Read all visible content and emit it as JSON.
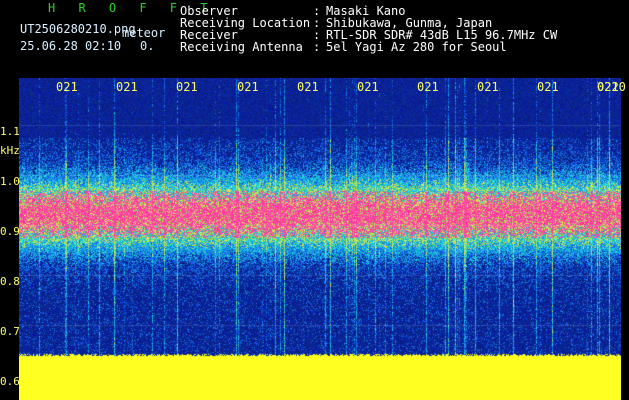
{
  "app": {
    "title": "H R O F F T"
  },
  "header": {
    "filename": "UT2506280210.png",
    "mode": "meteor",
    "date_time": "25.06.28 02:10",
    "count": "0.",
    "rows": [
      {
        "label": "Observer",
        "value": "Masaki Kano"
      },
      {
        "label": "Receiving Location",
        "value": "Shibukawa, Gunma, Japan"
      },
      {
        "label": "Receiver",
        "value": "RTL-SDR SDR# 43dB L15 96.7MHz CW"
      },
      {
        "label": "Receiving Antenna",
        "value": "5el Yagi Az 280 for Seoul"
      }
    ]
  },
  "axis": {
    "unit": "kHz",
    "y_ticks": [
      "1.1",
      "1.0",
      "0.9",
      "0.8",
      "0.7",
      "0.6"
    ],
    "time_ticks": [
      "021",
      "021",
      "021",
      "021",
      "021",
      "021",
      "021",
      "021",
      "021",
      "021",
      "0220"
    ]
  },
  "colors": {
    "background": "#000000",
    "spectrum_low": "#0a1a8c",
    "spectrum_mid": "#1aa0c8",
    "spectrum_high": "#ff3c8c",
    "noise_floor": "#ffff22"
  }
}
